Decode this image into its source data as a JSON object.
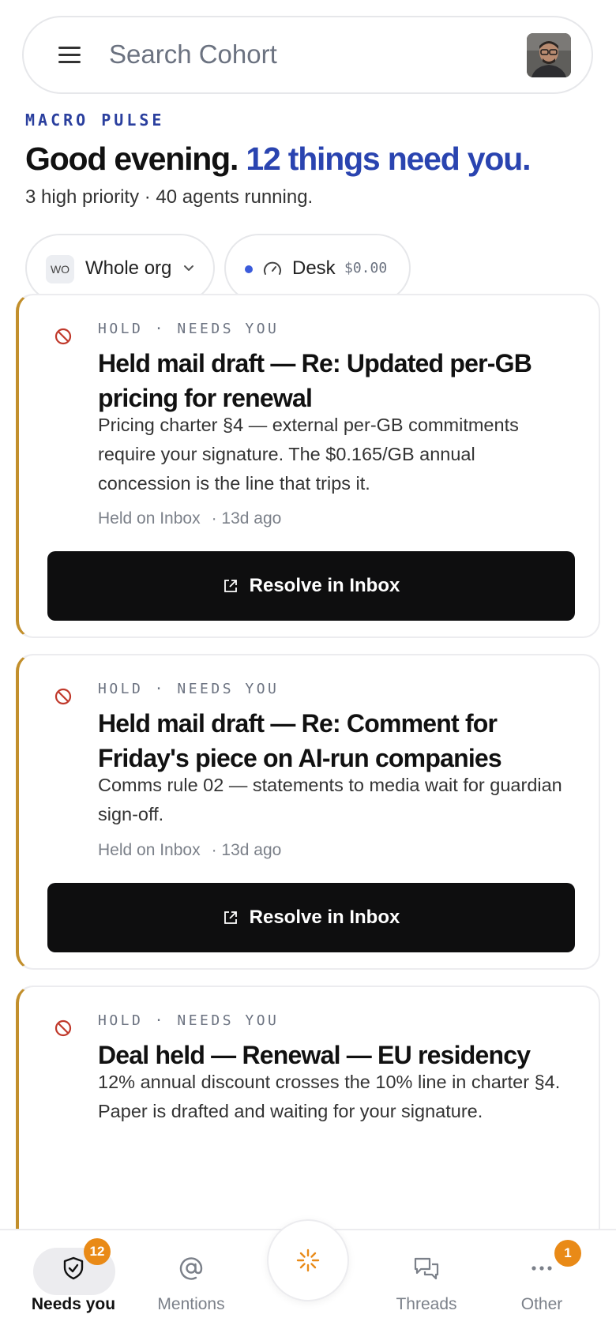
{
  "search": {
    "placeholder": "Search Cohort"
  },
  "header": {
    "eyebrow": "MACRO PULSE",
    "greeting": "Good evening.",
    "count_text": "12 things need you.",
    "subline": "3 high priority · 40 agents running."
  },
  "filters": {
    "org_badge": "WO",
    "org_label": "Whole org",
    "desk_label": "Desk",
    "desk_amount": "$0.00"
  },
  "cards": [
    {
      "tag": "HOLD · NEEDS YOU",
      "title": "Held mail draft — Re: Updated per-GB pricing for renewal",
      "body": "Pricing charter §4 — external per-GB commitments require your signature. The $0.165/GB annual concession is the line that trips it.",
      "source": "Held on Inbox",
      "age": "· 13d ago",
      "button": "Resolve in Inbox"
    },
    {
      "tag": "HOLD · NEEDS YOU",
      "title": "Held mail draft — Re: Comment for Friday's piece on AI-run companies",
      "body": "Comms rule 02 — statements to media wait for guardian sign-off.",
      "source": "Held on Inbox",
      "age": "· 13d ago",
      "button": "Resolve in Inbox"
    },
    {
      "tag": "HOLD · NEEDS YOU",
      "title": "Deal held — Renewal — EU residency",
      "body": "12% annual discount crosses the 10% line in charter §4. Paper is drafted and waiting for your signature."
    }
  ],
  "nav": {
    "needs_you": {
      "label": "Needs you",
      "badge": "12"
    },
    "mentions": {
      "label": "Mentions"
    },
    "threads": {
      "label": "Threads"
    },
    "other": {
      "label": "Other",
      "badge": "1"
    }
  },
  "colors": {
    "accent_blue": "#2a44b0",
    "hold_border": "#c28f2c",
    "badge_orange": "#e98a17",
    "hold_icon_red": "#c0392b"
  }
}
